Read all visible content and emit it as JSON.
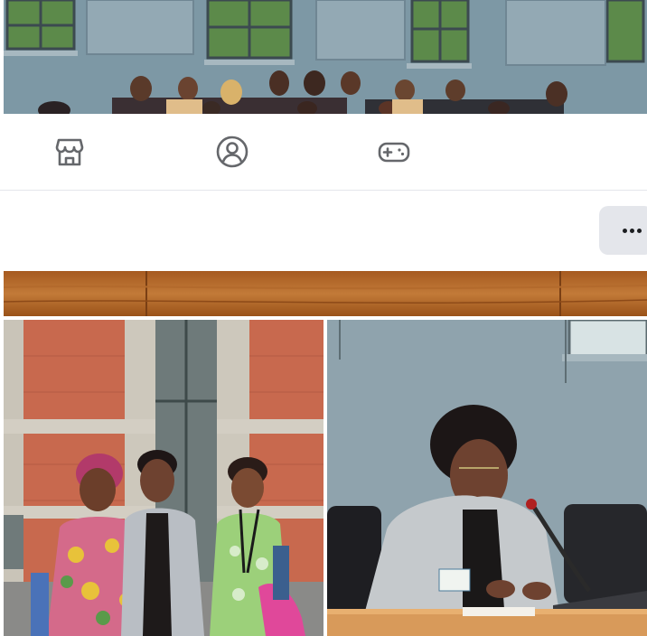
{
  "photos": {
    "top": {
      "description_icon": "group-photo"
    },
    "middle": {
      "description_icon": "wood-panel-photo"
    },
    "left": {
      "description_icon": "three-women-photo"
    },
    "right": {
      "description_icon": "woman-at-desk-photo"
    }
  },
  "nav": {
    "items": [
      {
        "icon": "marketplace-icon"
      },
      {
        "icon": "profile-icon"
      },
      {
        "icon": "gaming-icon"
      }
    ]
  },
  "post": {
    "more_button_icon": "more-dots-icon"
  },
  "colors": {
    "icon": "#65676b",
    "button_bg": "#e4e6eb",
    "divider": "#e4e6eb"
  }
}
